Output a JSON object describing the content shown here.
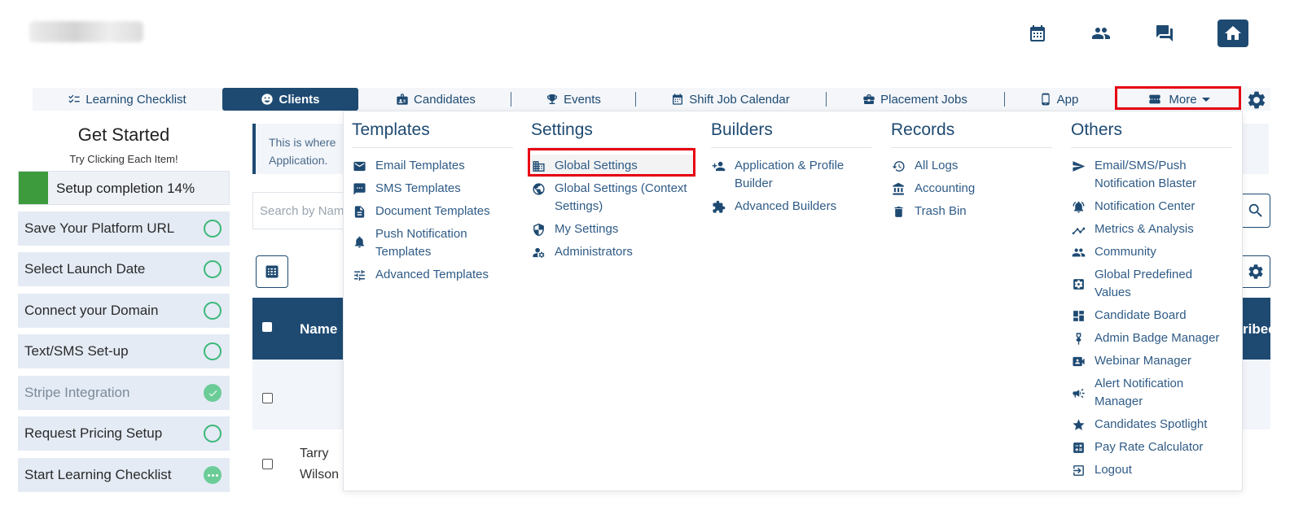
{
  "header": {
    "icons": [
      "calendar-icon",
      "people-icon",
      "chat-icon",
      "home-icon"
    ]
  },
  "nav": {
    "tabs": [
      {
        "label": "Learning Checklist",
        "icon": "checklist-icon"
      },
      {
        "label": "Clients",
        "icon": "smile-icon",
        "active": true
      },
      {
        "label": "Candidates",
        "icon": "badge-icon"
      },
      {
        "label": "Events",
        "icon": "trophy-icon"
      },
      {
        "label": "Shift Job Calendar",
        "icon": "calendar-icon"
      },
      {
        "label": "Placement Jobs",
        "icon": "briefcase-icon"
      },
      {
        "label": "App",
        "icon": "phone-icon"
      },
      {
        "label": "More",
        "icon": "ticket-icon"
      }
    ]
  },
  "sidebar": {
    "title": "Get Started",
    "subtitle": "Try Clicking Each Item!",
    "progress_label": "Setup completion 14%",
    "progress_fraction": 0.14,
    "items": [
      {
        "label": "Save Your Platform URL",
        "status": "open"
      },
      {
        "label": "Select Launch Date",
        "status": "open"
      },
      {
        "label": "Connect your Domain",
        "status": "open"
      },
      {
        "label": "Text/SMS Set-up",
        "status": "open"
      },
      {
        "label": "Stripe Integration",
        "status": "done"
      },
      {
        "label": "Request Pricing Setup",
        "status": "open"
      },
      {
        "label": "Start Learning Checklist",
        "status": "in-progress"
      }
    ]
  },
  "main": {
    "info_line1": "This is where",
    "info_line2": "Application.",
    "search_placeholder": "Search by Nam",
    "table": {
      "col_name": "Name",
      "col_right": "ribec",
      "row2_name_line1": "Tarry",
      "row2_name_line2": "Wilson"
    }
  },
  "menu": {
    "columns": [
      {
        "heading": "Templates",
        "items": [
          {
            "label": "Email Templates",
            "icon": "envelope-icon"
          },
          {
            "label": "SMS Templates",
            "icon": "sms-icon"
          },
          {
            "label": "Document Templates",
            "icon": "document-icon"
          },
          {
            "label": "Push Notification Templates",
            "icon": "bell-icon"
          },
          {
            "label": "Advanced Templates",
            "icon": "sliders-icon"
          }
        ]
      },
      {
        "heading": "Settings",
        "items": [
          {
            "label": "Global Settings",
            "icon": "building-icon"
          },
          {
            "label": "Global Settings (Context Settings)",
            "icon": "globe-gear-icon"
          },
          {
            "label": "My Settings",
            "icon": "shield-gear-icon"
          },
          {
            "label": "Administrators",
            "icon": "user-gear-icon"
          }
        ]
      },
      {
        "heading": "Builders",
        "items": [
          {
            "label": "Application & Profile Builder",
            "icon": "user-plus-icon"
          },
          {
            "label": "Advanced Builders",
            "icon": "puzzle-icon"
          }
        ]
      },
      {
        "heading": "Records",
        "items": [
          {
            "label": "All Logs",
            "icon": "history-icon"
          },
          {
            "label": "Accounting",
            "icon": "bank-icon"
          },
          {
            "label": "Trash Bin",
            "icon": "trash-icon"
          }
        ]
      },
      {
        "heading": "Others",
        "items": [
          {
            "label": "Email/SMS/Push Notification Blaster",
            "icon": "send-icon"
          },
          {
            "label": "Notification Center",
            "icon": "bell-ring-icon"
          },
          {
            "label": "Metrics & Analysis",
            "icon": "chart-line-icon"
          },
          {
            "label": "Community",
            "icon": "people-icon"
          },
          {
            "label": "Global Predefined Values",
            "icon": "gear-square-icon"
          },
          {
            "label": "Candidate Board",
            "icon": "dashboard-icon"
          },
          {
            "label": "Admin Badge Manager",
            "icon": "medal-icon"
          },
          {
            "label": "Webinar Manager",
            "icon": "video-user-icon"
          },
          {
            "label": "Alert Notification Manager",
            "icon": "megaphone-icon"
          },
          {
            "label": "Candidates Spotlight",
            "icon": "star-icon"
          },
          {
            "label": "Pay Rate Calculator",
            "icon": "calculator-icon"
          },
          {
            "label": "Logout",
            "icon": "logout-icon"
          }
        ]
      }
    ]
  },
  "colors": {
    "primary": "#1e4a72",
    "highlight_box": "#e60012",
    "progress_fill": "#3d9a3d",
    "status_ring": "#3cb878"
  }
}
